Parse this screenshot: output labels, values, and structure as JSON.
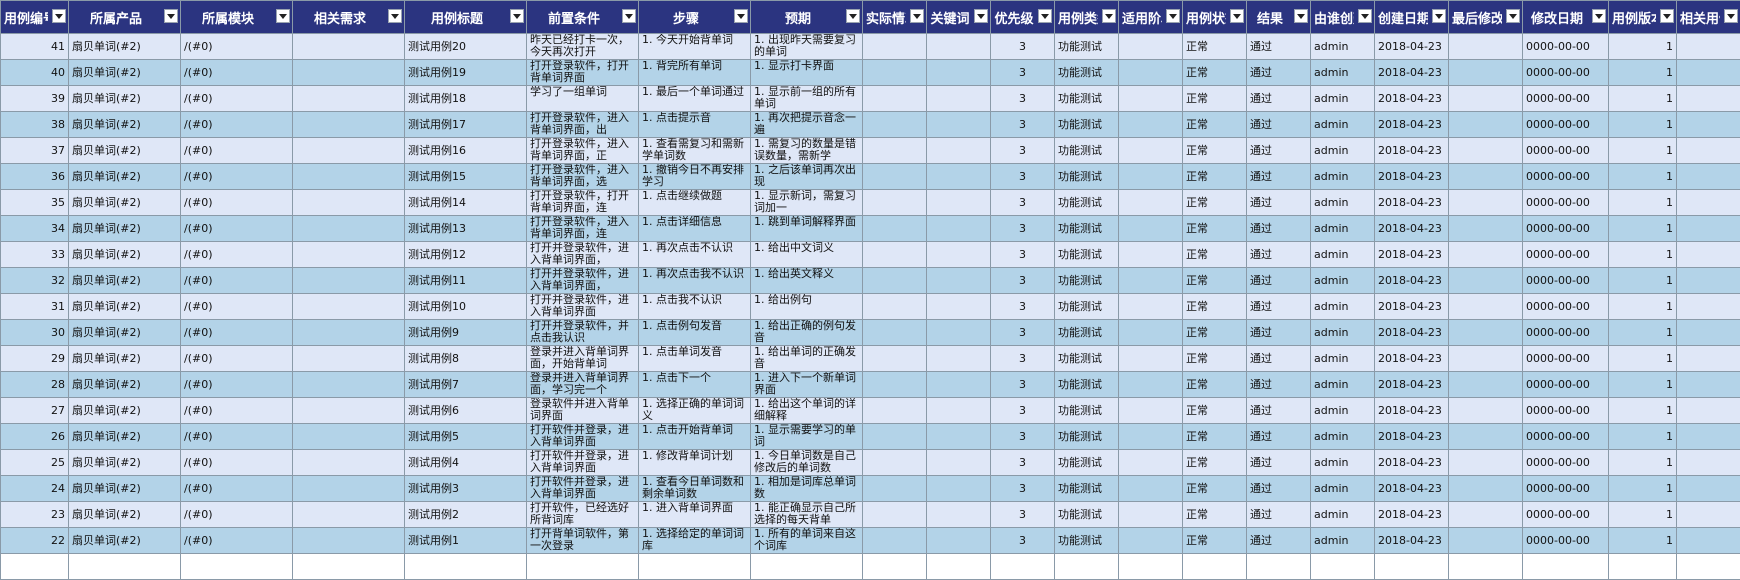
{
  "columns": [
    "用例编号",
    "所属产品",
    "所属模块",
    "相关需求",
    "用例标题",
    "前置条件",
    "步骤",
    "预期",
    "实际情况",
    "关键词",
    "优先级",
    "用例类型",
    "适用阶段",
    "用例状态",
    "结果",
    "由谁创建",
    "创建日期",
    "最后修改者",
    "修改日期",
    "用例版本",
    "相关用例"
  ],
  "colors": {
    "header_bg": "#2b3480",
    "row_odd": "#dfe7f7",
    "row_even": "#b3d3e8"
  },
  "rows": [
    {
      "id": "41",
      "product": "扇贝单词(#2)",
      "module": "/(#0)",
      "story": "",
      "title": "测试用例20",
      "precondition": "昨天已经打卡一次，今天再次打开",
      "steps": "1. 今天开始背单词",
      "expect": "1. 出现昨天需要复习的单词",
      "real": "",
      "keywords": "",
      "pri": "3",
      "type": "功能测试",
      "stage": "",
      "status": "正常",
      "result": "通过",
      "opener": "admin",
      "opened": "2018-04-23",
      "editor": "",
      "edited": "0000-00-00",
      "version": "1",
      "linked": ""
    },
    {
      "id": "40",
      "product": "扇贝单词(#2)",
      "module": "/(#0)",
      "story": "",
      "title": "测试用例19",
      "precondition": "打开登录软件，打开背单词界面",
      "steps": "1. 背完所有单词",
      "expect": "1. 显示打卡界面",
      "real": "",
      "keywords": "",
      "pri": "3",
      "type": "功能测试",
      "stage": "",
      "status": "正常",
      "result": "通过",
      "opener": "admin",
      "opened": "2018-04-23",
      "editor": "",
      "edited": "0000-00-00",
      "version": "1",
      "linked": ""
    },
    {
      "id": "39",
      "product": "扇贝单词(#2)",
      "module": "/(#0)",
      "story": "",
      "title": "测试用例18",
      "precondition": "学习了一组单词",
      "steps": "1. 最后一个单词通过",
      "expect": "1. 显示前一组的所有单词",
      "real": "",
      "keywords": "",
      "pri": "3",
      "type": "功能测试",
      "stage": "",
      "status": "正常",
      "result": "通过",
      "opener": "admin",
      "opened": "2018-04-23",
      "editor": "",
      "edited": "0000-00-00",
      "version": "1",
      "linked": ""
    },
    {
      "id": "38",
      "product": "扇贝单词(#2)",
      "module": "/(#0)",
      "story": "",
      "title": "测试用例17",
      "precondition": "打开登录软件，进入背单词界面，出",
      "steps": "1. 点击提示音",
      "expect": "1. 再次把提示音念一遍",
      "real": "",
      "keywords": "",
      "pri": "3",
      "type": "功能测试",
      "stage": "",
      "status": "正常",
      "result": "通过",
      "opener": "admin",
      "opened": "2018-04-23",
      "editor": "",
      "edited": "0000-00-00",
      "version": "1",
      "linked": ""
    },
    {
      "id": "37",
      "product": "扇贝单词(#2)",
      "module": "/(#0)",
      "story": "",
      "title": "测试用例16",
      "precondition": "打开登录软件，进入背单词界面，正",
      "steps": "1. 查看需复习和需新学单词数",
      "expect": "1. 需复习的数量是错误数量，需新学",
      "real": "",
      "keywords": "",
      "pri": "3",
      "type": "功能测试",
      "stage": "",
      "status": "正常",
      "result": "通过",
      "opener": "admin",
      "opened": "2018-04-23",
      "editor": "",
      "edited": "0000-00-00",
      "version": "1",
      "linked": ""
    },
    {
      "id": "36",
      "product": "扇贝单词(#2)",
      "module": "/(#0)",
      "story": "",
      "title": "测试用例15",
      "precondition": "打开登录软件，进入背单词界面，选",
      "steps": "1. 撤销今日不再安排学习",
      "expect": "1. 之后该单词再次出现",
      "real": "",
      "keywords": "",
      "pri": "3",
      "type": "功能测试",
      "stage": "",
      "status": "正常",
      "result": "通过",
      "opener": "admin",
      "opened": "2018-04-23",
      "editor": "",
      "edited": "0000-00-00",
      "version": "1",
      "linked": ""
    },
    {
      "id": "35",
      "product": "扇贝单词(#2)",
      "module": "/(#0)",
      "story": "",
      "title": "测试用例14",
      "precondition": "打开登录软件，打开背单词界面，连",
      "steps": "1. 点击继续做题",
      "expect": "1. 显示新词，需复习词加一",
      "real": "",
      "keywords": "",
      "pri": "3",
      "type": "功能测试",
      "stage": "",
      "status": "正常",
      "result": "通过",
      "opener": "admin",
      "opened": "2018-04-23",
      "editor": "",
      "edited": "0000-00-00",
      "version": "1",
      "linked": ""
    },
    {
      "id": "34",
      "product": "扇贝单词(#2)",
      "module": "/(#0)",
      "story": "",
      "title": "测试用例13",
      "precondition": "打开登录软件，进入背单词界面，连",
      "steps": "1. 点击详细信息",
      "expect": "1. 跳到单词解释界面",
      "real": "",
      "keywords": "",
      "pri": "3",
      "type": "功能测试",
      "stage": "",
      "status": "正常",
      "result": "通过",
      "opener": "admin",
      "opened": "2018-04-23",
      "editor": "",
      "edited": "0000-00-00",
      "version": "1",
      "linked": ""
    },
    {
      "id": "33",
      "product": "扇贝单词(#2)",
      "module": "/(#0)",
      "story": "",
      "title": "测试用例12",
      "precondition": "打开并登录软件，进入背单词界面，",
      "steps": "1. 再次点击不认识",
      "expect": "1. 给出中文词义",
      "real": "",
      "keywords": "",
      "pri": "3",
      "type": "功能测试",
      "stage": "",
      "status": "正常",
      "result": "通过",
      "opener": "admin",
      "opened": "2018-04-23",
      "editor": "",
      "edited": "0000-00-00",
      "version": "1",
      "linked": ""
    },
    {
      "id": "32",
      "product": "扇贝单词(#2)",
      "module": "/(#0)",
      "story": "",
      "title": "测试用例11",
      "precondition": "打开并登录软件，进入背单词界面，",
      "steps": "1. 再次点击我不认识",
      "expect": "1. 给出英文释义",
      "real": "",
      "keywords": "",
      "pri": "3",
      "type": "功能测试",
      "stage": "",
      "status": "正常",
      "result": "通过",
      "opener": "admin",
      "opened": "2018-04-23",
      "editor": "",
      "edited": "0000-00-00",
      "version": "1",
      "linked": ""
    },
    {
      "id": "31",
      "product": "扇贝单词(#2)",
      "module": "/(#0)",
      "story": "",
      "title": "测试用例10",
      "precondition": "打开并登录软件，进入背单词界面",
      "steps": "1. 点击我不认识",
      "expect": "1. 给出例句",
      "real": "",
      "keywords": "",
      "pri": "3",
      "type": "功能测试",
      "stage": "",
      "status": "正常",
      "result": "通过",
      "opener": "admin",
      "opened": "2018-04-23",
      "editor": "",
      "edited": "0000-00-00",
      "version": "1",
      "linked": ""
    },
    {
      "id": "30",
      "product": "扇贝单词(#2)",
      "module": "/(#0)",
      "story": "",
      "title": "测试用例9",
      "precondition": "打开并登录软件，并点击我认识",
      "steps": "1. 点击例句发音",
      "expect": "1. 给出正确的例句发音",
      "real": "",
      "keywords": "",
      "pri": "3",
      "type": "功能测试",
      "stage": "",
      "status": "正常",
      "result": "通过",
      "opener": "admin",
      "opened": "2018-04-23",
      "editor": "",
      "edited": "0000-00-00",
      "version": "1",
      "linked": ""
    },
    {
      "id": "29",
      "product": "扇贝单词(#2)",
      "module": "/(#0)",
      "story": "",
      "title": "测试用例8",
      "precondition": "登录并进入背单词界面，开始背单词",
      "steps": "1. 点击单词发音",
      "expect": "1. 给出单词的正确发音",
      "real": "",
      "keywords": "",
      "pri": "3",
      "type": "功能测试",
      "stage": "",
      "status": "正常",
      "result": "通过",
      "opener": "admin",
      "opened": "2018-04-23",
      "editor": "",
      "edited": "0000-00-00",
      "version": "1",
      "linked": ""
    },
    {
      "id": "28",
      "product": "扇贝单词(#2)",
      "module": "/(#0)",
      "story": "",
      "title": "测试用例7",
      "precondition": "登录并进入背单词界面，学习完一个",
      "steps": "1. 点击下一个",
      "expect": "1. 进入下一个新单词界面",
      "real": "",
      "keywords": "",
      "pri": "3",
      "type": "功能测试",
      "stage": "",
      "status": "正常",
      "result": "通过",
      "opener": "admin",
      "opened": "2018-04-23",
      "editor": "",
      "edited": "0000-00-00",
      "version": "1",
      "linked": ""
    },
    {
      "id": "27",
      "product": "扇贝单词(#2)",
      "module": "/(#0)",
      "story": "",
      "title": "测试用例6",
      "precondition": "登录软件并进入背单词界面",
      "steps": "1. 选择正确的单词词义",
      "expect": "1. 给出这个单词的详细解释",
      "real": "",
      "keywords": "",
      "pri": "3",
      "type": "功能测试",
      "stage": "",
      "status": "正常",
      "result": "通过",
      "opener": "admin",
      "opened": "2018-04-23",
      "editor": "",
      "edited": "0000-00-00",
      "version": "1",
      "linked": ""
    },
    {
      "id": "26",
      "product": "扇贝单词(#2)",
      "module": "/(#0)",
      "story": "",
      "title": "测试用例5",
      "precondition": "打开软件并登录，进入背单词界面",
      "steps": "1. 点击开始背单词",
      "expect": "1. 显示需要学习的单词",
      "real": "",
      "keywords": "",
      "pri": "3",
      "type": "功能测试",
      "stage": "",
      "status": "正常",
      "result": "通过",
      "opener": "admin",
      "opened": "2018-04-23",
      "editor": "",
      "edited": "0000-00-00",
      "version": "1",
      "linked": ""
    },
    {
      "id": "25",
      "product": "扇贝单词(#2)",
      "module": "/(#0)",
      "story": "",
      "title": "测试用例4",
      "precondition": "打开软件并登录，进入背单词界面",
      "steps": "1. 修改背单词计划",
      "expect": "1. 今日单词数是自己修改后的单词数",
      "real": "",
      "keywords": "",
      "pri": "3",
      "type": "功能测试",
      "stage": "",
      "status": "正常",
      "result": "通过",
      "opener": "admin",
      "opened": "2018-04-23",
      "editor": "",
      "edited": "0000-00-00",
      "version": "1",
      "linked": ""
    },
    {
      "id": "24",
      "product": "扇贝单词(#2)",
      "module": "/(#0)",
      "story": "",
      "title": "测试用例3",
      "precondition": "打开软件并登录，进入背单词界面",
      "steps": "1. 查看今日单词数和剩余单词数",
      "expect": "1. 相加是词库总单词数",
      "real": "",
      "keywords": "",
      "pri": "3",
      "type": "功能测试",
      "stage": "",
      "status": "正常",
      "result": "通过",
      "opener": "admin",
      "opened": "2018-04-23",
      "editor": "",
      "edited": "0000-00-00",
      "version": "1",
      "linked": ""
    },
    {
      "id": "23",
      "product": "扇贝单词(#2)",
      "module": "/(#0)",
      "story": "",
      "title": "测试用例2",
      "precondition": "打开软件，已经选好所背词库",
      "steps": "1. 进入背单词界面",
      "expect": "1. 能正确显示自己所选择的每天背单",
      "real": "",
      "keywords": "",
      "pri": "3",
      "type": "功能测试",
      "stage": "",
      "status": "正常",
      "result": "通过",
      "opener": "admin",
      "opened": "2018-04-23",
      "editor": "",
      "edited": "0000-00-00",
      "version": "1",
      "linked": ""
    },
    {
      "id": "22",
      "product": "扇贝单词(#2)",
      "module": "/(#0)",
      "story": "",
      "title": "测试用例1",
      "precondition": "打开背单词软件，第一次登录",
      "steps": "1. 选择给定的单词词库",
      "expect": "1. 所有的单词来自这个词库",
      "real": "",
      "keywords": "",
      "pri": "3",
      "type": "功能测试",
      "stage": "",
      "status": "正常",
      "result": "通过",
      "opener": "admin",
      "opened": "2018-04-23",
      "editor": "",
      "edited": "0000-00-00",
      "version": "1",
      "linked": ""
    }
  ]
}
